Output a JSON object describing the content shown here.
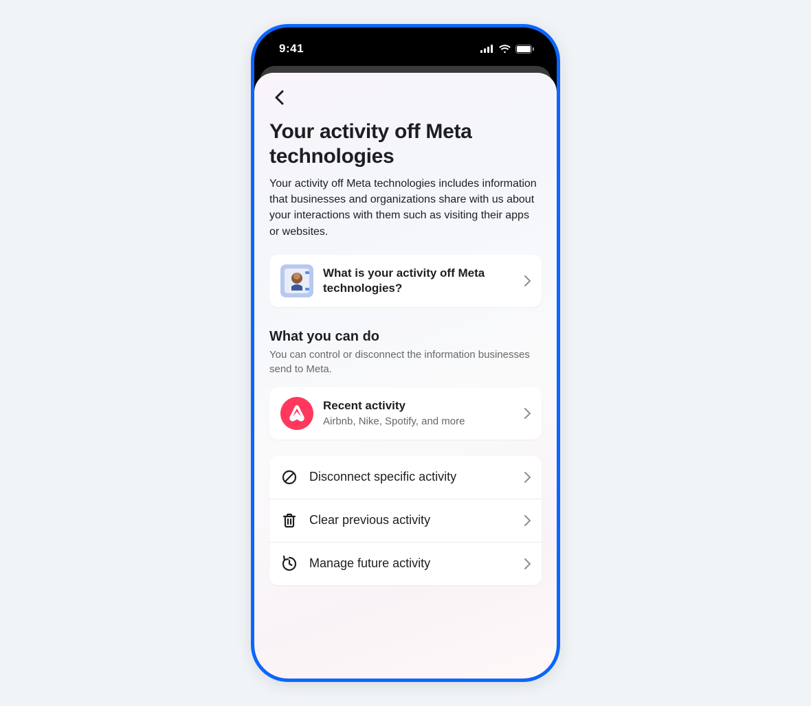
{
  "status": {
    "time": "9:41"
  },
  "header": {
    "title": "Your activity off Meta technologies",
    "description": "Your activity off Meta technologies includes information that businesses and organizations share with us about your interactions with them such as visiting their apps or websites."
  },
  "info_card": {
    "title": "What is your activity off Meta technologies?"
  },
  "section": {
    "title": "What you can do",
    "subtitle": "You can control or disconnect the information businesses send to Meta."
  },
  "recent": {
    "title": "Recent activity",
    "subtitle": "Airbnb, Nike, Spotify, and more",
    "icon_color": "#ff385c"
  },
  "actions": [
    {
      "label": "Disconnect specific activity",
      "icon": "block"
    },
    {
      "label": "Clear previous activity",
      "icon": "trash"
    },
    {
      "label": "Manage future activity",
      "icon": "clock-refresh"
    }
  ]
}
